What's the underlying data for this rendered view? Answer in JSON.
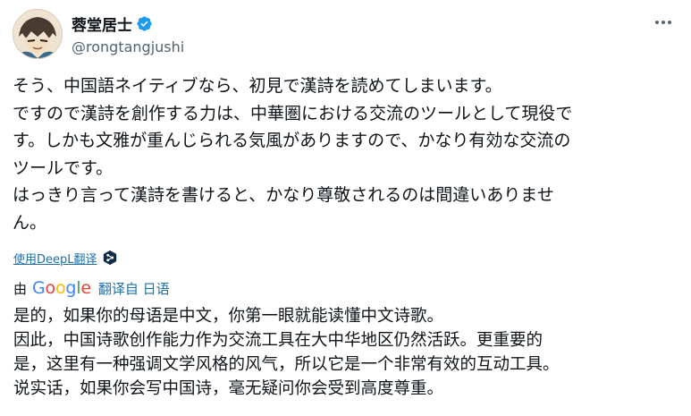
{
  "author": {
    "display_name": "蓉堂居士",
    "handle": "@rongtangjushi",
    "verified_color": "#1d9bf0"
  },
  "tweet": {
    "lines": [
      "そう、中国語ネイティブなら、初見で漢詩を読めてしまいます。",
      "ですので漢詩を創作する力は、中華圏における交流のツールとして現役で",
      "す。しかも文雅が重んじられる気風がありますので、かなり有効な交流の",
      "ツールです。",
      "はっきり言って漢詩を書けると、かなり尊敬されるのは間違いありませ",
      "ん。"
    ]
  },
  "deepl": {
    "link_label": "使用DeepL翻译",
    "icon": "deepl-icon"
  },
  "translation_source": {
    "by_label": "由",
    "google_letters": [
      "G",
      "o",
      "o",
      "g",
      "l",
      "e"
    ],
    "translated_from_label": "翻译自 日语"
  },
  "translation": {
    "lines": [
      "是的，如果你的母语是中文，你第一眼就能读懂中文诗歌。",
      "因此，中国诗歌创作能力作为交流工具在大中华地区仍然活跃。更重要的",
      "是，这里有一种强调文学风格的风气，所以它是一个非常有效的互动工具。",
      "说实话，如果你会写中国诗，毫无疑问你会受到高度尊重。"
    ]
  },
  "colors": {
    "link": "#1d6fa5",
    "secondary_text": "#536471",
    "primary_text": "#0f1419"
  }
}
